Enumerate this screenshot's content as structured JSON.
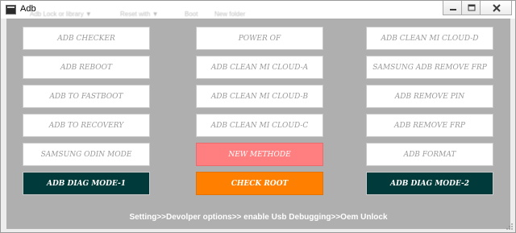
{
  "window": {
    "title": "Adb",
    "menu": [
      "Adb Lock or library ▼",
      "Reset with ▼",
      "Boot",
      "New folder"
    ]
  },
  "buttons": {
    "col1": [
      {
        "label": "ADB CHECKER"
      },
      {
        "label": "ADB REBOOT"
      },
      {
        "label": "ADB TO FASTBOOT"
      },
      {
        "label": "ADB TO RECOVERY"
      },
      {
        "label": "SAMSUNG ODIN MODE"
      },
      {
        "label": "ADB DIAG MODE-1"
      }
    ],
    "col2": [
      {
        "label": "POWER OF"
      },
      {
        "label": "ADB CLEAN MI CLOUD-A"
      },
      {
        "label": "ADB CLEAN MI CLOUD-B"
      },
      {
        "label": "ADB CLEAN MI CLOUD-C"
      },
      {
        "label": "NEW METHODE"
      },
      {
        "label": "CHECK ROOT"
      }
    ],
    "col3": [
      {
        "label": "ADB CLEAN MI CLOUD-D"
      },
      {
        "label": "SAMSUNG ADB REMOVE FRP"
      },
      {
        "label": "ADB REMOVE PIN"
      },
      {
        "label": "ADB REMOVE FRP"
      },
      {
        "label": "ADB FORMAT"
      },
      {
        "label": "ADB DIAG MODE-2"
      }
    ]
  },
  "footer_note": "Setting>>Devolper options>> enable Usb Debugging>>Oem Unlock",
  "colors": {
    "client_bg": "#afafaf",
    "button_bg": "#ffffff",
    "button_text": "#9a9a9a",
    "pink": "#ff7f80",
    "orange": "#ff7f00",
    "dark_teal": "#003a3a"
  }
}
